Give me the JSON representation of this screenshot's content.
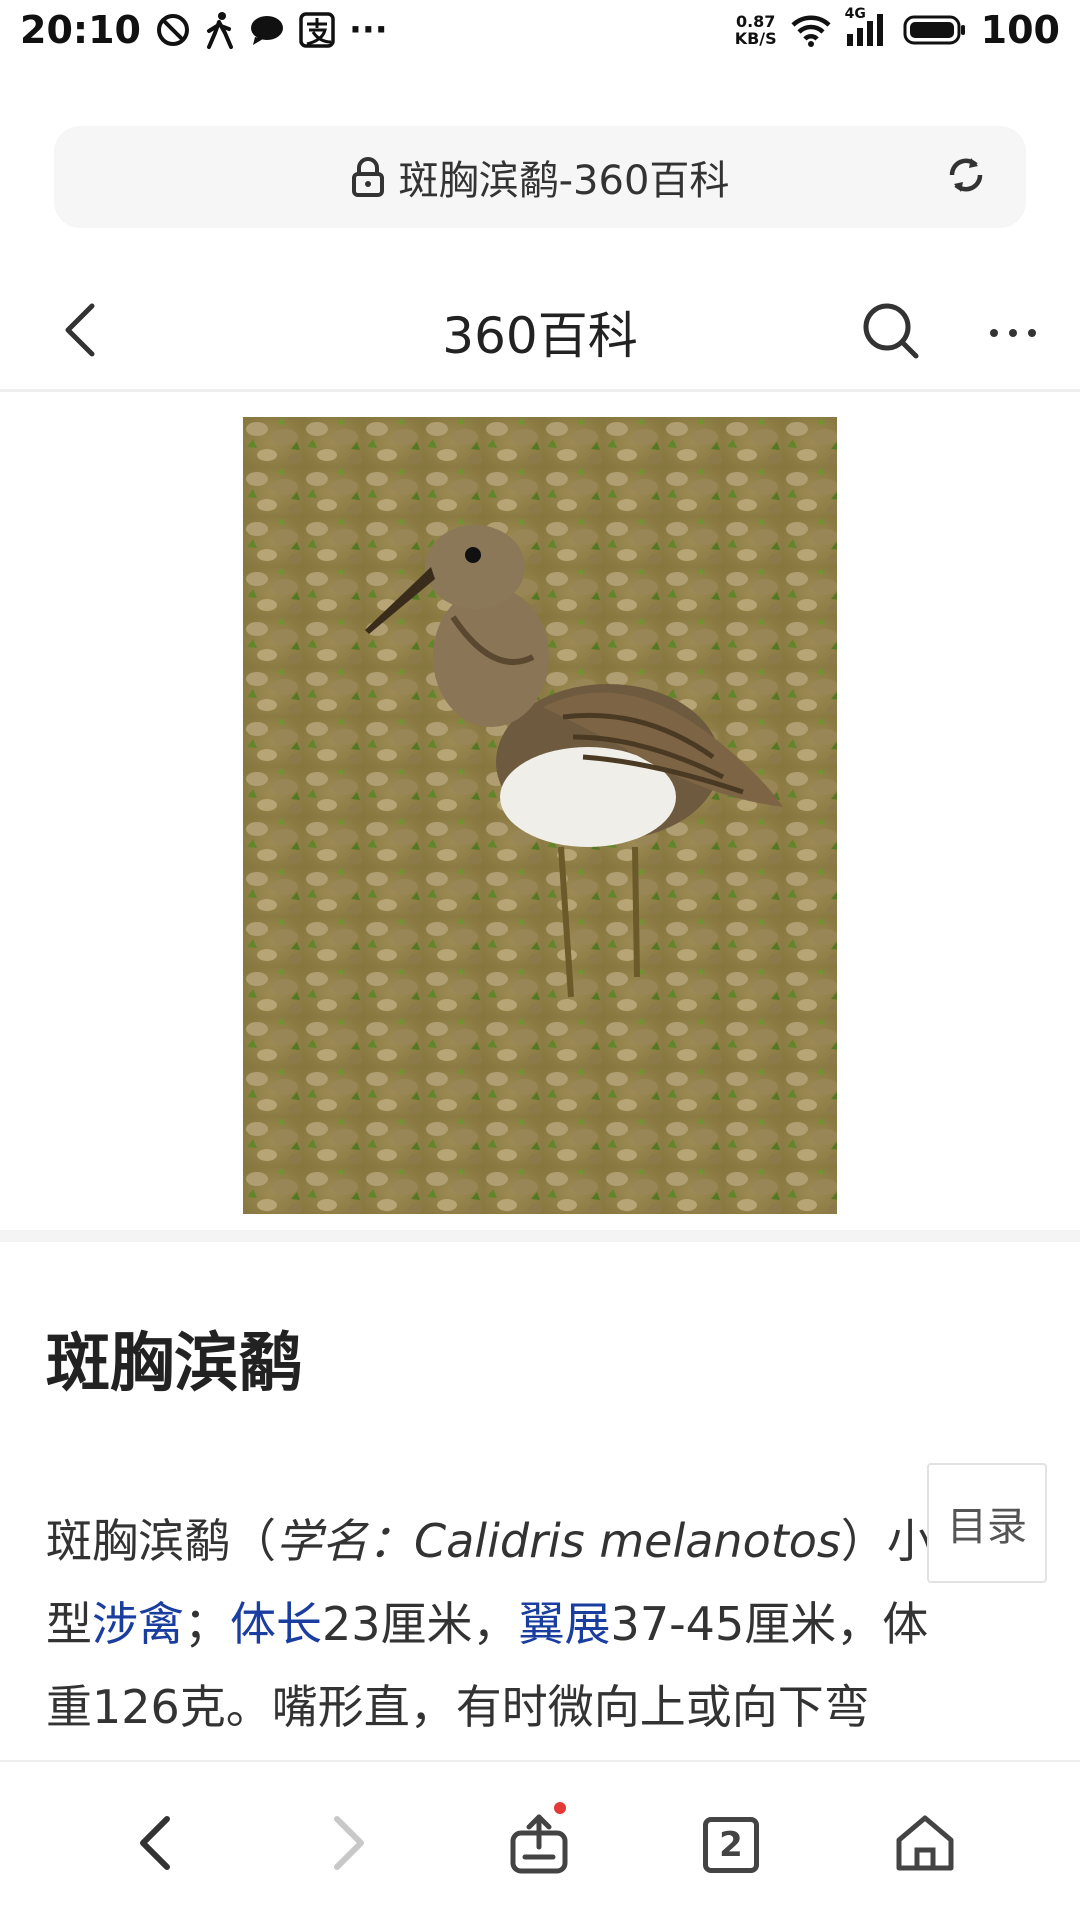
{
  "status_bar": {
    "time": "20:10",
    "icons_left": [
      "do-not-disturb-icon",
      "walking-icon",
      "message-icon",
      "alipay-icon",
      "more-dots-icon"
    ],
    "more_indicator": "···",
    "net_speed_value": "0.87",
    "net_speed_unit": "KB/S",
    "network_label": "4G",
    "battery_level": "100"
  },
  "address_bar": {
    "lock_icon": "lock-icon",
    "page_title": "斑胸滨鹬-360百科",
    "reload_icon": "reload-icon"
  },
  "page_nav": {
    "title": "360百科",
    "back_icon": "chevron-left-icon",
    "search_icon": "search-icon",
    "more_icon": "more-horizontal-icon"
  },
  "article": {
    "title": "斑胸滨鹬",
    "body_line1_prefix": "斑胸滨鹬（",
    "body_sci_label": "学名：Calidris melanotos",
    "body_line1_suffix": "）小",
    "body_line2_a": "型",
    "body_link_1": "涉禽",
    "body_line2_b": "；",
    "body_link_2": "体长",
    "body_line2_c": "23厘米，",
    "body_link_3": "翼展",
    "body_line2_d": "37-45厘米，体",
    "body_line3": "重126克。嘴形直，有时微向上或向下弯"
  },
  "toc_button": {
    "label": "目录"
  },
  "bottom_bar": {
    "tab_count": "2",
    "icons": [
      "back-icon",
      "forward-icon",
      "share-icon",
      "tabs-icon",
      "home-icon"
    ]
  },
  "colors": {
    "link": "#1a3ea0",
    "notification_dot": "#e53935",
    "disabled_icon": "#c8c8c8"
  }
}
